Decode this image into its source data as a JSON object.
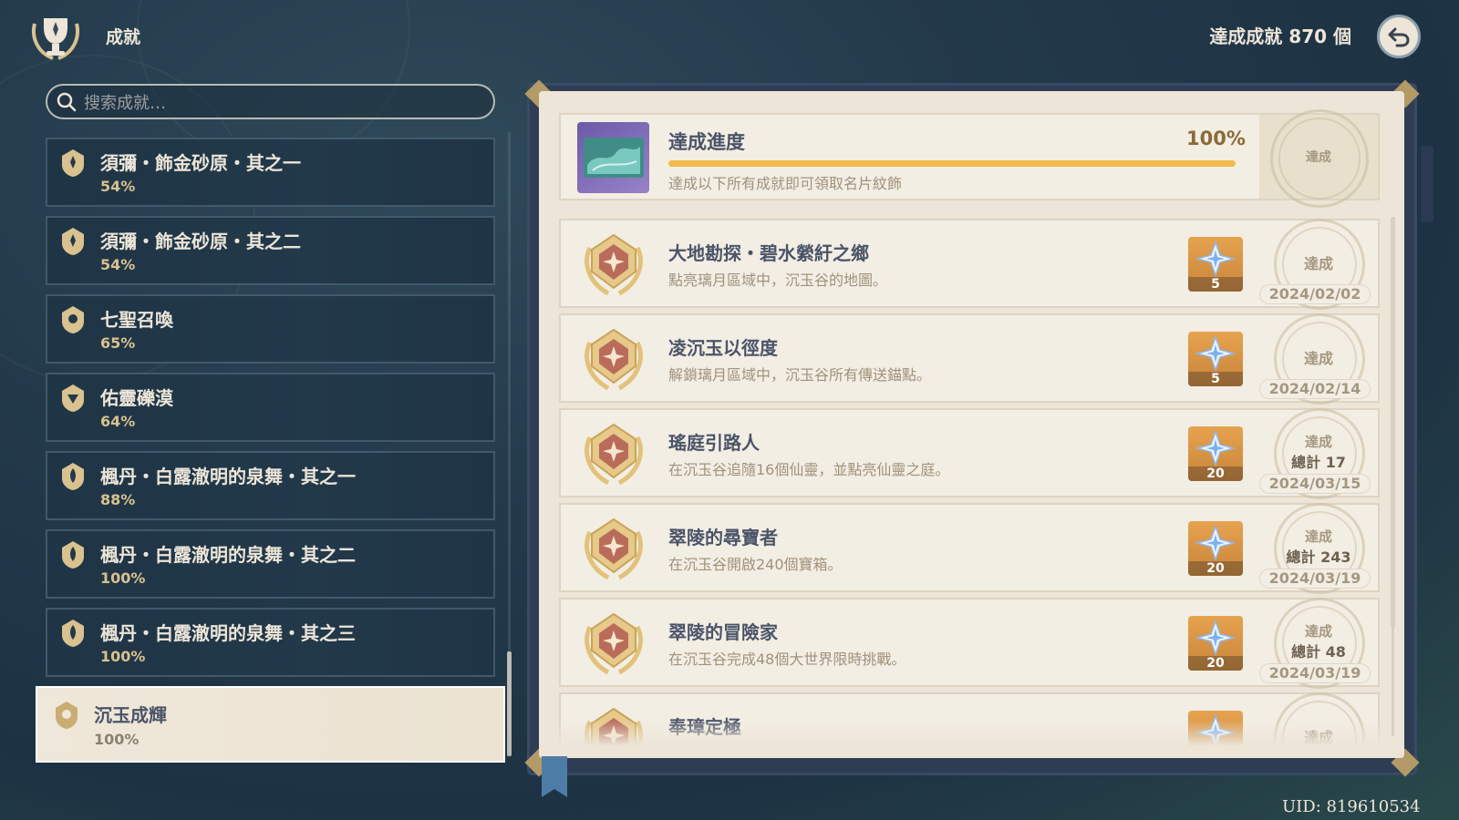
{
  "header": {
    "title": "成就",
    "count_label": "達成成就 870 個"
  },
  "search": {
    "placeholder": "搜索成就…"
  },
  "categories": [
    {
      "label": "須彌・飾金砂原・其之一",
      "percent": "54%"
    },
    {
      "label": "須彌・飾金砂原・其之二",
      "percent": "54%"
    },
    {
      "label": "七聖召喚",
      "percent": "65%"
    },
    {
      "label": "佑靈礫漠",
      "percent": "64%"
    },
    {
      "label": "楓丹・白露澈明的泉舞・其之一",
      "percent": "88%"
    },
    {
      "label": "楓丹・白露澈明的泉舞・其之二",
      "percent": "100%"
    },
    {
      "label": "楓丹・白露澈明的泉舞・其之三",
      "percent": "100%"
    },
    {
      "label": "沉玉成輝",
      "percent": "100%",
      "selected": true
    }
  ],
  "progress": {
    "title": "達成進度",
    "percent_label": "100%",
    "percent_value": 1.0,
    "description": "達成以下所有成就即可領取名片紋飾",
    "stamp": "達成"
  },
  "achievements": [
    {
      "title": "大地勘探・碧水縈紆之鄉",
      "description": "點亮璃月區域中，沉玉谷的地圖。",
      "reward": "5",
      "stamp": "達成",
      "total": "",
      "date": "2024/02/02"
    },
    {
      "title": "凌沉玉以徑度",
      "description": "解鎖璃月區域中，沉玉谷所有傳送錨點。",
      "reward": "5",
      "stamp": "達成",
      "total": "",
      "date": "2024/02/14"
    },
    {
      "title": "瑤庭引路人",
      "description": "在沉玉谷追隨16個仙靈，並點亮仙靈之庭。",
      "reward": "20",
      "stamp": "達成",
      "total": "總計 17",
      "date": "2024/03/15"
    },
    {
      "title": "翠陵的尋寶者",
      "description": "在沉玉谷開啟240個寶箱。",
      "reward": "20",
      "stamp": "達成",
      "total": "總計 243",
      "date": "2024/03/19"
    },
    {
      "title": "翠陵的冒險家",
      "description": "在沉玉谷完成48個大世界限時挑戰。",
      "reward": "20",
      "stamp": "達成",
      "total": "總計 48",
      "date": "2024/03/19"
    },
    {
      "title": "奉璋定極",
      "description": "",
      "reward": "",
      "stamp": "達成",
      "total": "",
      "date": ""
    }
  ],
  "footer": {
    "uid": "UID: 819610534"
  },
  "icons": {
    "trophy": "trophy-laurel-icon",
    "back": "back-arrow-icon",
    "search": "search-icon",
    "category": "achievement-badge-icon",
    "medal": "gold-medal-icon",
    "reward": "primogem-icon",
    "namecard": "namecard-icon"
  },
  "colors": {
    "gold_accent": "#f2b94b",
    "title_text": "#4b5468",
    "desc_text": "#a0917b",
    "page_bg": "#ece5d8",
    "reward_bg": "#d99445"
  }
}
